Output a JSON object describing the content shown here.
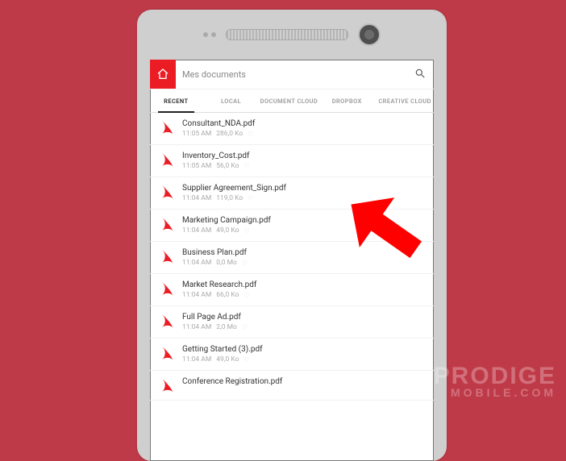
{
  "header": {
    "title": "Mes documents"
  },
  "tabs": [
    {
      "id": "recent",
      "label": "RECENT",
      "active": true
    },
    {
      "id": "local",
      "label": "LOCAL",
      "active": false
    },
    {
      "id": "document-cloud",
      "label": "DOCUMENT CLOUD",
      "active": false
    },
    {
      "id": "dropbox",
      "label": "DROPBOX",
      "active": false
    },
    {
      "id": "creative-cloud",
      "label": "CREATIVE CLOUD",
      "active": false
    }
  ],
  "files": [
    {
      "name": "Consultant_NDA.pdf",
      "time": "11:05 AM",
      "size": "286,0 Ko"
    },
    {
      "name": "Inventory_Cost.pdf",
      "time": "11:05 AM",
      "size": "56,0 Ko"
    },
    {
      "name": "Supplier Agreement_Sign.pdf",
      "time": "11:04 AM",
      "size": "119,0 Ko"
    },
    {
      "name": "Marketing Campaign.pdf",
      "time": "11:04 AM",
      "size": "49,0 Ko"
    },
    {
      "name": "Business Plan.pdf",
      "time": "11:04 AM",
      "size": "0,0 Mo"
    },
    {
      "name": "Market Research.pdf",
      "time": "11:04 AM",
      "size": "66,0 Ko"
    },
    {
      "name": "Full Page Ad.pdf",
      "time": "11:04 AM",
      "size": "2,0 Mo"
    },
    {
      "name": "Getting Started (3).pdf",
      "time": "11:04 AM",
      "size": "49,0 Ko"
    },
    {
      "name": "Conference Registration.pdf",
      "time": "",
      "size": ""
    }
  ],
  "watermark": {
    "line1": "PRODIGE",
    "line2": "MOBILE.COM"
  }
}
